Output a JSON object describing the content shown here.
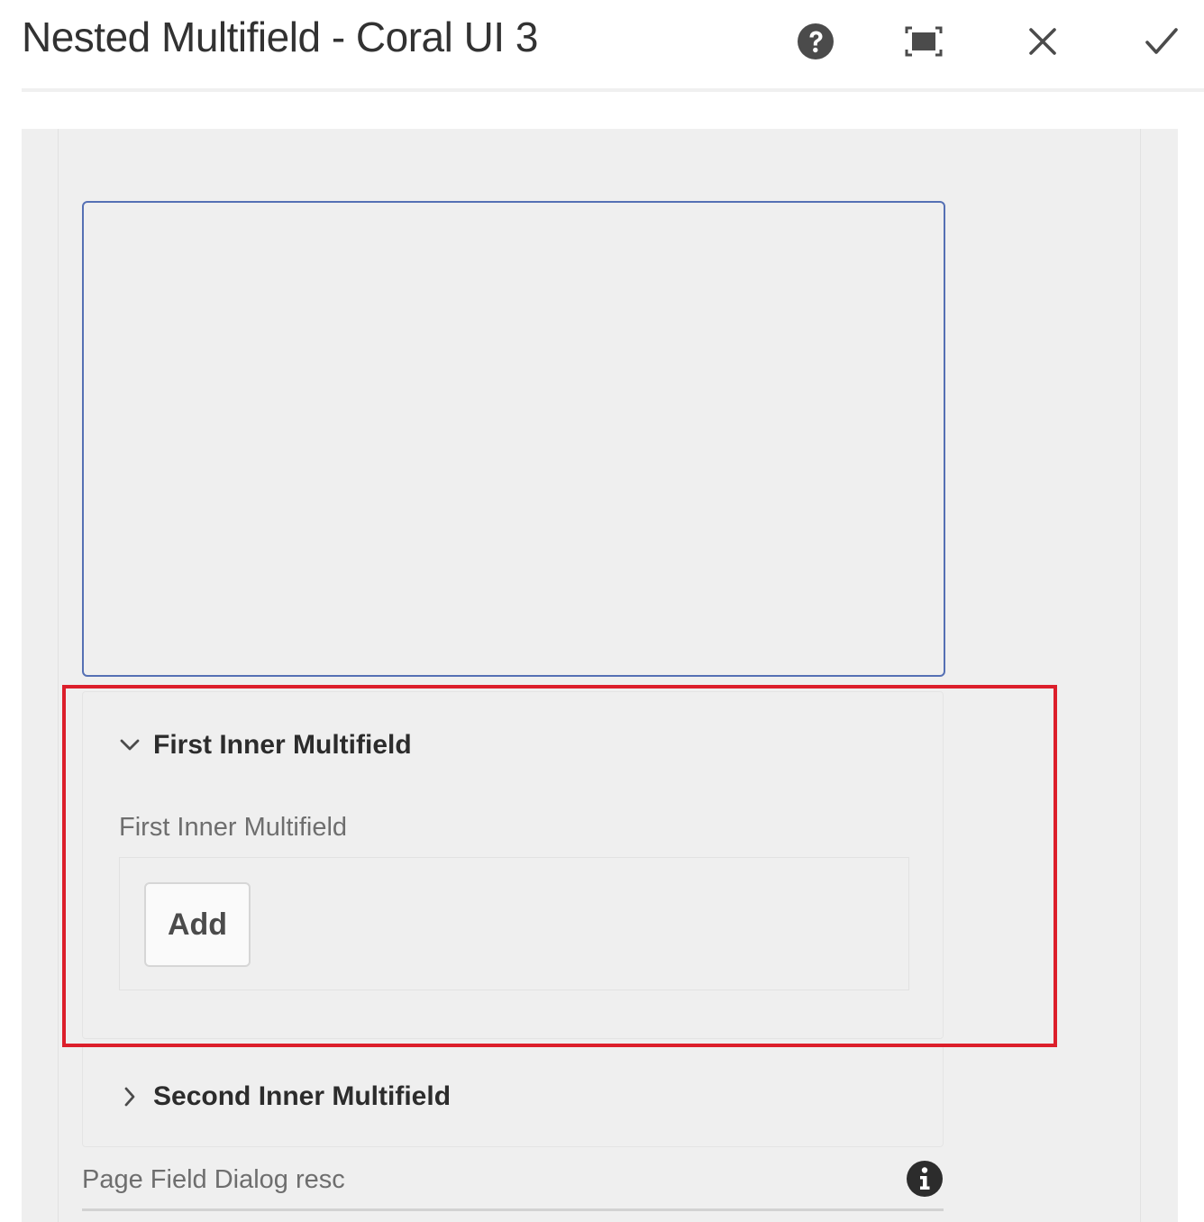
{
  "dialog": {
    "title": "Nested Multifield - Coral UI 3",
    "actions": [
      {
        "name": "help-button",
        "icon": "help-icon"
      },
      {
        "name": "fullscreen-button",
        "icon": "fullscreen-icon"
      },
      {
        "name": "cancel-button",
        "icon": "close-icon"
      },
      {
        "name": "done-button",
        "icon": "checkmark-icon"
      }
    ]
  },
  "accordion": {
    "first": {
      "title": "First Inner Multifield",
      "expanded": true,
      "field_label": "First Inner Multifield",
      "add_label": "Add"
    },
    "second": {
      "title": "Second Inner Multifield",
      "expanded": false
    }
  },
  "page_field": {
    "label": "Page Field Dialog resc",
    "info_icon": "info-icon"
  },
  "colors": {
    "accent": "#5570b4",
    "highlight": "#dc1f2b",
    "panel": "#efefef"
  }
}
